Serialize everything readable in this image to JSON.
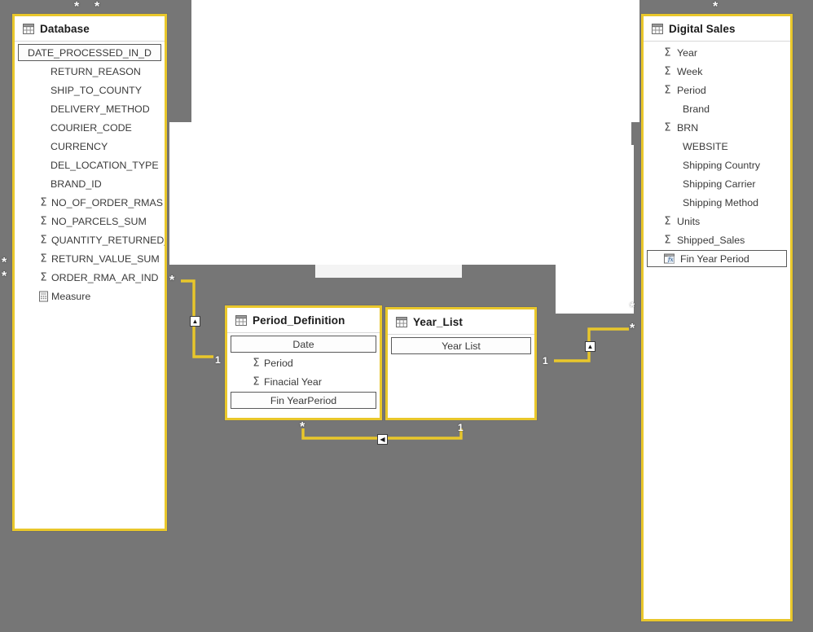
{
  "app": {
    "view_name": "Model view",
    "canvas_color": "#767676",
    "accent_color": "#E9C72B",
    "card_background": "#FFFFFF"
  },
  "tables": [
    {
      "id": "database",
      "name": "Database",
      "icon": "table-icon",
      "fields": [
        {
          "label": "DATE_PROCESSED_IN_D",
          "icon": "none",
          "style": "boxed-centered"
        },
        {
          "label": "RETURN_REASON",
          "icon": "none",
          "style": "plain"
        },
        {
          "label": "SHIP_TO_COUNTY",
          "icon": "none",
          "style": "plain"
        },
        {
          "label": "DELIVERY_METHOD",
          "icon": "none",
          "style": "plain"
        },
        {
          "label": "COURIER_CODE",
          "icon": "none",
          "style": "plain"
        },
        {
          "label": "CURRENCY",
          "icon": "none",
          "style": "plain"
        },
        {
          "label": "DEL_LOCATION_TYPE",
          "icon": "none",
          "style": "plain"
        },
        {
          "label": "BRAND_ID",
          "icon": "none",
          "style": "plain"
        },
        {
          "label": "NO_OF_ORDER_RMAS",
          "icon": "sigma-icon",
          "style": "plain"
        },
        {
          "label": "NO_PARCELS_SUM",
          "icon": "sigma-icon",
          "style": "plain"
        },
        {
          "label": "QUANTITY_RETURNED_",
          "icon": "sigma-icon",
          "style": "plain"
        },
        {
          "label": "RETURN_VALUE_SUM",
          "icon": "sigma-icon",
          "style": "plain"
        },
        {
          "label": "ORDER_RMA_AR_IND",
          "icon": "sigma-icon",
          "style": "plain"
        },
        {
          "label": "Measure",
          "icon": "measure-icon",
          "style": "plain"
        }
      ]
    },
    {
      "id": "period_definition",
      "name": "Period_Definition",
      "icon": "table-icon",
      "fields": [
        {
          "label": "Date",
          "icon": "none",
          "style": "boxed-centered"
        },
        {
          "label": "Period",
          "icon": "sigma-icon",
          "style": "plain"
        },
        {
          "label": "Finacial Year",
          "icon": "sigma-icon",
          "style": "plain"
        },
        {
          "label": "Fin YearPeriod",
          "icon": "none",
          "style": "boxed-centered"
        }
      ]
    },
    {
      "id": "year_list",
      "name": "Year_List",
      "icon": "table-icon",
      "fields": [
        {
          "label": "Year List",
          "icon": "none",
          "style": "boxed-centered"
        }
      ]
    },
    {
      "id": "digital_sales",
      "name": "Digital Sales",
      "icon": "table-icon",
      "fields": [
        {
          "label": "Year",
          "icon": "sigma-icon",
          "style": "plain"
        },
        {
          "label": "Week",
          "icon": "sigma-icon",
          "style": "plain"
        },
        {
          "label": "Period",
          "icon": "sigma-icon",
          "style": "plain"
        },
        {
          "label": "Brand",
          "icon": "none",
          "style": "plain"
        },
        {
          "label": "BRN",
          "icon": "sigma-icon",
          "style": "plain"
        },
        {
          "label": "WEBSITE",
          "icon": "none",
          "style": "plain"
        },
        {
          "label": "Shipping Country",
          "icon": "none",
          "style": "plain"
        },
        {
          "label": "Shipping Carrier",
          "icon": "none",
          "style": "plain"
        },
        {
          "label": "Shipping Method",
          "icon": "none",
          "style": "plain"
        },
        {
          "label": "Units",
          "icon": "sigma-icon",
          "style": "plain"
        },
        {
          "label": "Shipped_Sales",
          "icon": "sigma-icon",
          "style": "plain"
        },
        {
          "label": "Fin Year Period",
          "icon": "calculated-column-icon",
          "style": "boxed"
        }
      ]
    }
  ],
  "relationships": [
    {
      "id": "rel-db-period",
      "from_card": "*",
      "to_card": "1",
      "direction_glyph": "▲"
    },
    {
      "id": "rel-period-yearlist",
      "from_card": "*",
      "to_card": "1",
      "direction_glyph": "◀"
    },
    {
      "id": "rel-yearlist-ds",
      "from_card": "1",
      "to_card": "*",
      "direction_glyph": "▲"
    }
  ],
  "cardinality_labels": {
    "db_top_left": "*",
    "db_top_right": "*",
    "db_edge_left_upper": "*",
    "db_edge_left_lower": "*",
    "db_right_stub": "*",
    "period_left": "*",
    "period_right_one": "1",
    "period_bottom_star": "*",
    "yearlist_bottom_one": "1",
    "yearlist_right_one": "1",
    "ds_top_star": "*",
    "ds_left_upper_star": "*",
    "ds_left_lower_star": "*"
  }
}
